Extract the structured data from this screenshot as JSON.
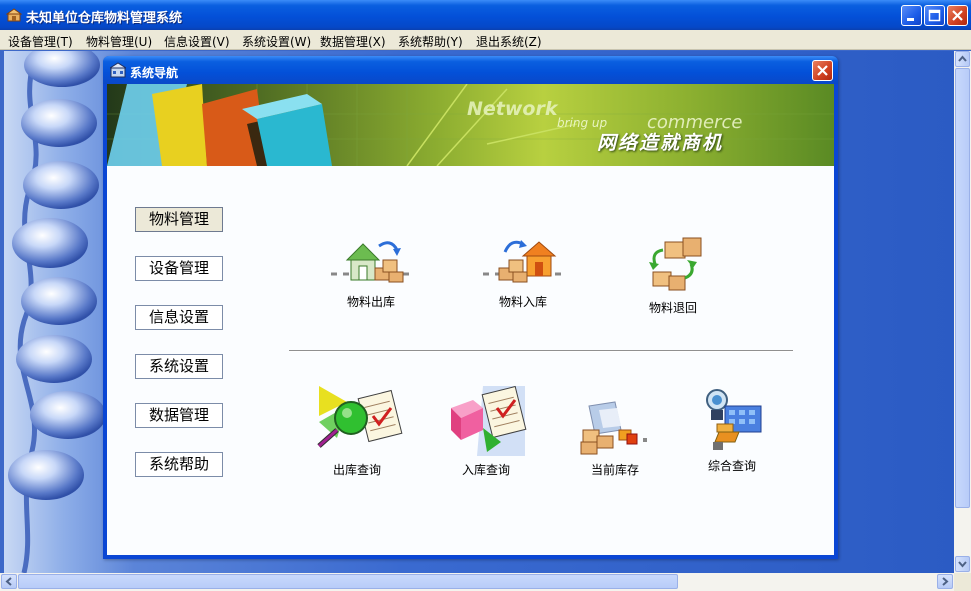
{
  "window": {
    "title": "未知单位仓库物料管理系统"
  },
  "menu": [
    "设备管理(T)",
    "物料管理(U)",
    "信息设置(V)",
    "系统设置(W)",
    "数据管理(X)",
    "系统帮助(Y)",
    "退出系统(Z)"
  ],
  "dialog": {
    "title": "系统导航",
    "banner": {
      "word1": "Network",
      "word2": "bring up",
      "word3": "commerce",
      "slogan": "网络造就商机"
    },
    "nav": [
      {
        "label": "物料管理",
        "active": true
      },
      {
        "label": "设备管理",
        "active": false
      },
      {
        "label": "信息设置",
        "active": false
      },
      {
        "label": "系统设置",
        "active": false
      },
      {
        "label": "数据管理",
        "active": false
      },
      {
        "label": "系统帮助",
        "active": false
      }
    ],
    "functions_top": [
      {
        "label": "物料出库",
        "icon": "warehouse-out-icon"
      },
      {
        "label": "物料入库",
        "icon": "warehouse-in-icon"
      },
      {
        "label": "物料退回",
        "icon": "material-return-icon"
      }
    ],
    "functions_bottom": [
      {
        "label": "出库查询",
        "icon": "outbound-query-icon"
      },
      {
        "label": "入库查询",
        "icon": "inbound-query-icon"
      },
      {
        "label": "当前库存",
        "icon": "current-stock-icon"
      },
      {
        "label": "综合查询",
        "icon": "comprehensive-query-icon"
      }
    ]
  },
  "colors": {
    "titlebar": "#0350d8",
    "close": "#d04020",
    "menubar": "#ece9d8",
    "desktop": "#3a6ad0"
  }
}
